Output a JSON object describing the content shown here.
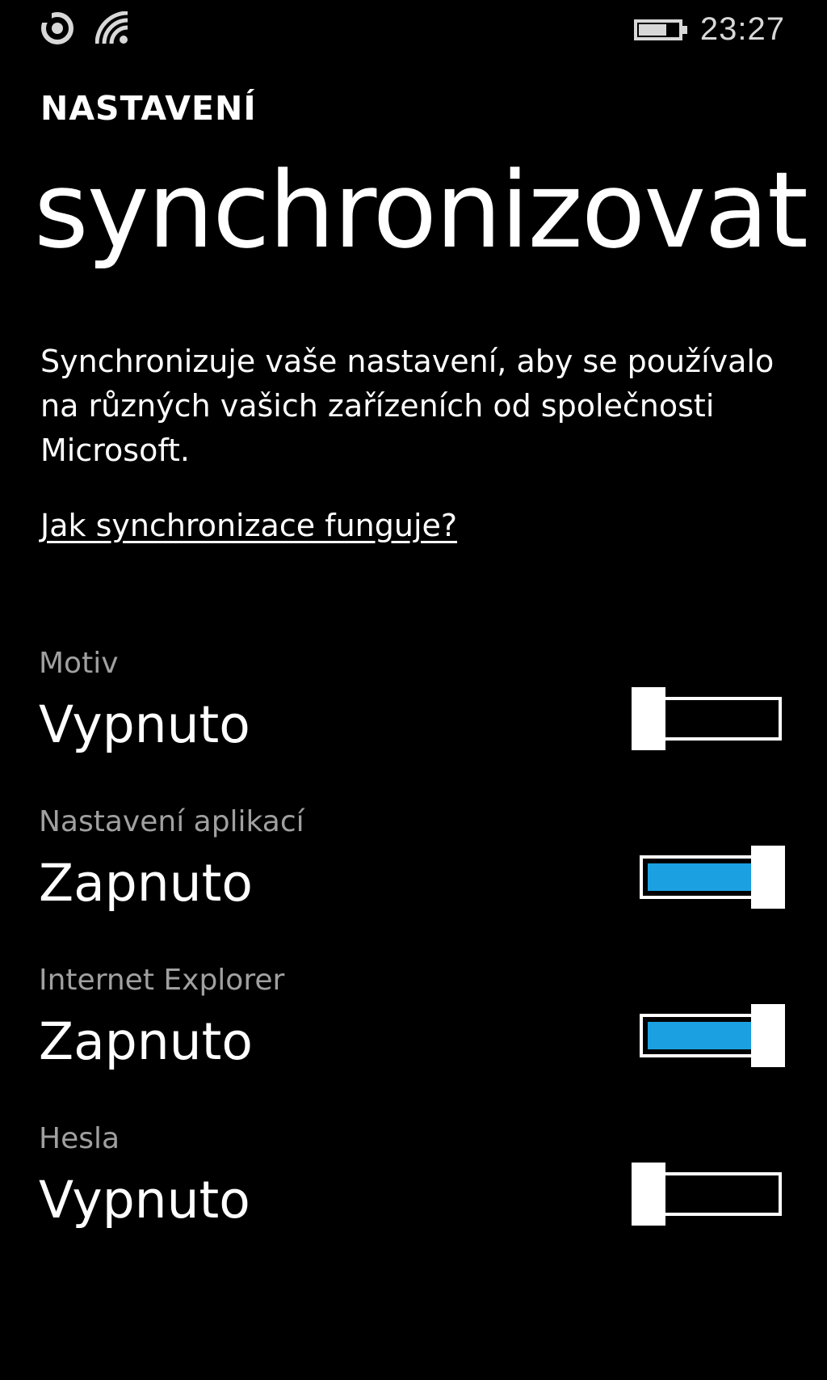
{
  "status_bar": {
    "icons_left": [
      "notification-icon",
      "wifi-icon"
    ],
    "battery_icon": "battery-icon",
    "time": "23:27"
  },
  "header": {
    "app_title": "NASTAVENÍ",
    "page_title": "synchronizovat"
  },
  "description": "Synchronizuje vaše nastavení, aby se používalo na různých vašich zařízeních od společnosti Microsoft.",
  "help_link": "Jak synchronizace funguje?",
  "accent_color": "#1ba1e2",
  "settings": [
    {
      "label": "Motiv",
      "value": "Vypnuto",
      "on": false
    },
    {
      "label": "Nastavení aplikací",
      "value": "Zapnuto",
      "on": true
    },
    {
      "label": "Internet Explorer",
      "value": "Zapnuto",
      "on": true
    },
    {
      "label": "Hesla",
      "value": "Vypnuto",
      "on": false
    }
  ]
}
